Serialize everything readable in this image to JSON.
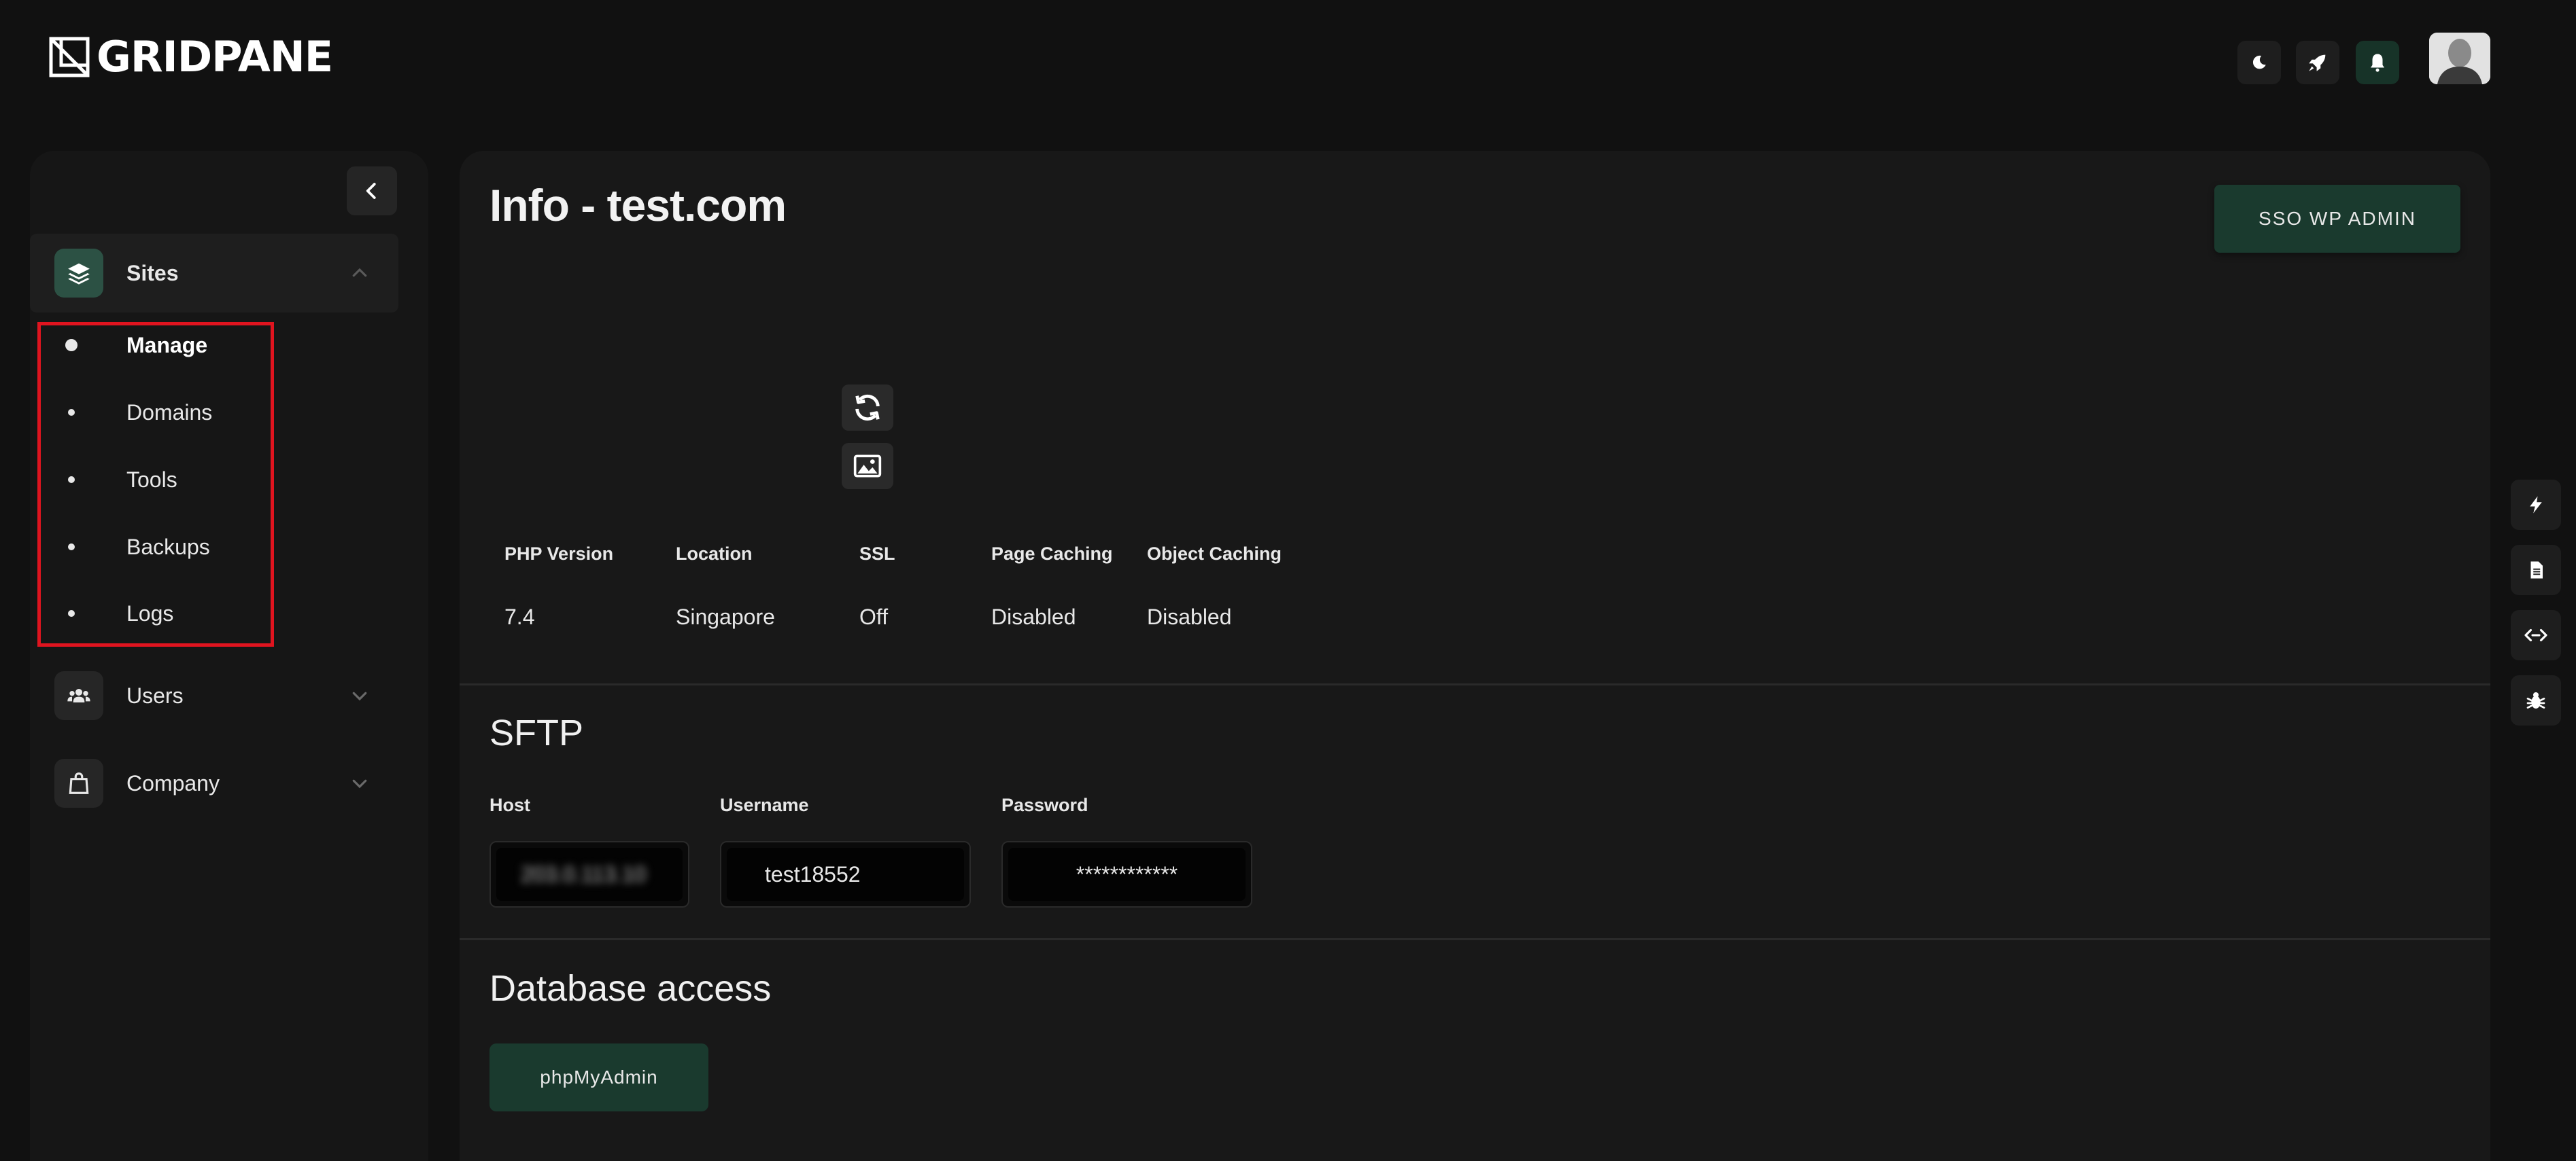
{
  "brand": {
    "logo_text": "GRIDPANE"
  },
  "header": {
    "buttons": [
      {
        "icon": "moon-icon"
      },
      {
        "icon": "rocket-icon"
      },
      {
        "icon": "bell-icon"
      }
    ],
    "avatar": "user-avatar"
  },
  "sidebar": {
    "collapse_icon": "chevron-left-icon",
    "items": [
      {
        "label": "Sites",
        "icon": "layers-icon",
        "expanded": true
      },
      {
        "label": "Users",
        "icon": "users-icon",
        "expanded": false
      },
      {
        "label": "Company",
        "icon": "shopping-bag-icon",
        "expanded": false
      }
    ],
    "sub_items": [
      {
        "label": "Manage",
        "active": true
      },
      {
        "label": "Domains",
        "active": false
      },
      {
        "label": "Tools",
        "active": false
      },
      {
        "label": "Backups",
        "active": false
      },
      {
        "label": "Logs",
        "active": false
      }
    ]
  },
  "main": {
    "title": "Info - test.com",
    "sso_button": "SSO WP ADMIN",
    "info": {
      "headers": [
        "PHP Version",
        "Location",
        "SSL",
        "Page Caching",
        "Object Caching"
      ],
      "values": [
        "7.4",
        "Singapore",
        "Off",
        "Disabled",
        "Disabled"
      ]
    },
    "sftp": {
      "title": "SFTP",
      "host_label": "Host",
      "host_value": "203.0.113.10",
      "username_label": "Username",
      "username_value": "test18552",
      "password_label": "Password",
      "password_value": "************"
    },
    "database": {
      "title": "Database access",
      "button": "phpMyAdmin"
    }
  },
  "right_rail": [
    "lightning-icon",
    "document-icon",
    "code-icon",
    "bug-icon"
  ],
  "colors": {
    "background": "#111111",
    "panel": "#181818",
    "accent_green": "#1a3a2e",
    "highlight_red": "#e0141f"
  }
}
